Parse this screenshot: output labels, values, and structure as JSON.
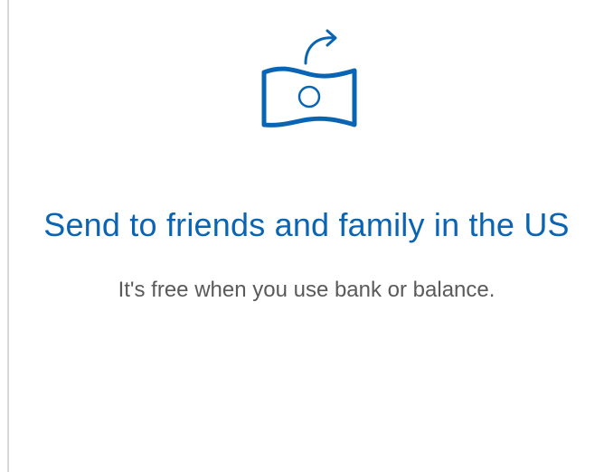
{
  "card": {
    "icon": "send-money-icon",
    "title": "Send to friends and family in the US",
    "description": "It's free when you use bank or balance."
  },
  "colors": {
    "accent": "#0a64b4",
    "body_text": "#5a5a5a",
    "divider": "#d9d9d9",
    "background": "#ffffff"
  }
}
